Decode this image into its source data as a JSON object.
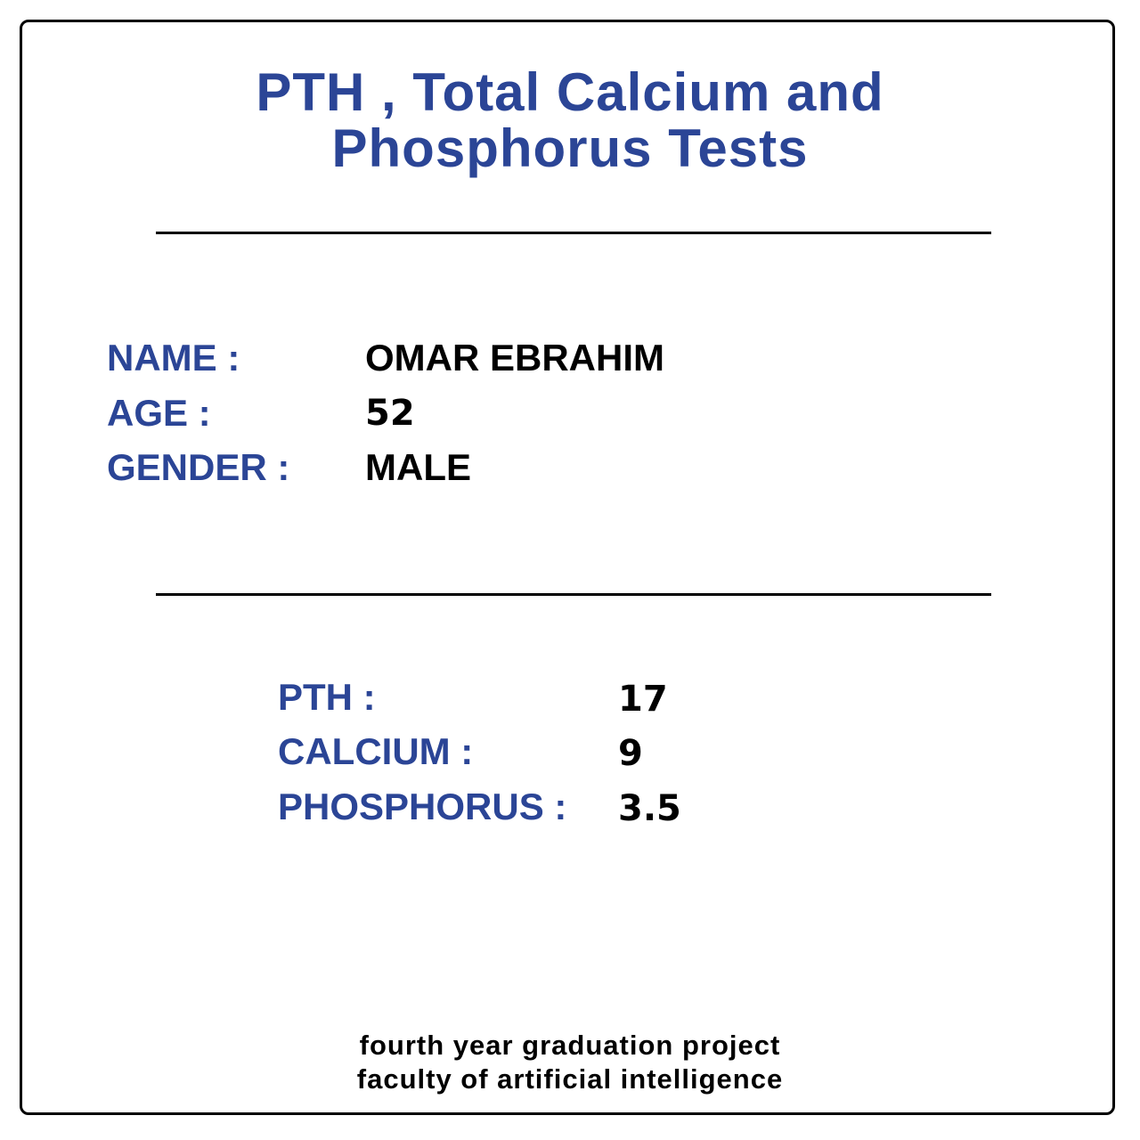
{
  "header": {
    "title_line1": "PTH , Total Calcium and",
    "title_line2": "Phosphorus Tests"
  },
  "patient": {
    "name_label": "NAME :",
    "name_value": "OMAR EBRAHIM",
    "age_label": "AGE :",
    "age_value": "52",
    "gender_label": "GENDER :",
    "gender_value": "MALE"
  },
  "results": {
    "pth_label": "PTH :",
    "pth_value": "17",
    "calcium_label": "CALCIUM :",
    "calcium_value": "9",
    "phosphorus_label": "PHOSPHORUS :",
    "phosphorus_value": "3.5"
  },
  "footer": {
    "line1": "fourth year graduation project",
    "line2": "faculty of artificial intelligence"
  },
  "colors": {
    "accent": "#2b4596",
    "text": "#000000",
    "border": "#000000"
  }
}
